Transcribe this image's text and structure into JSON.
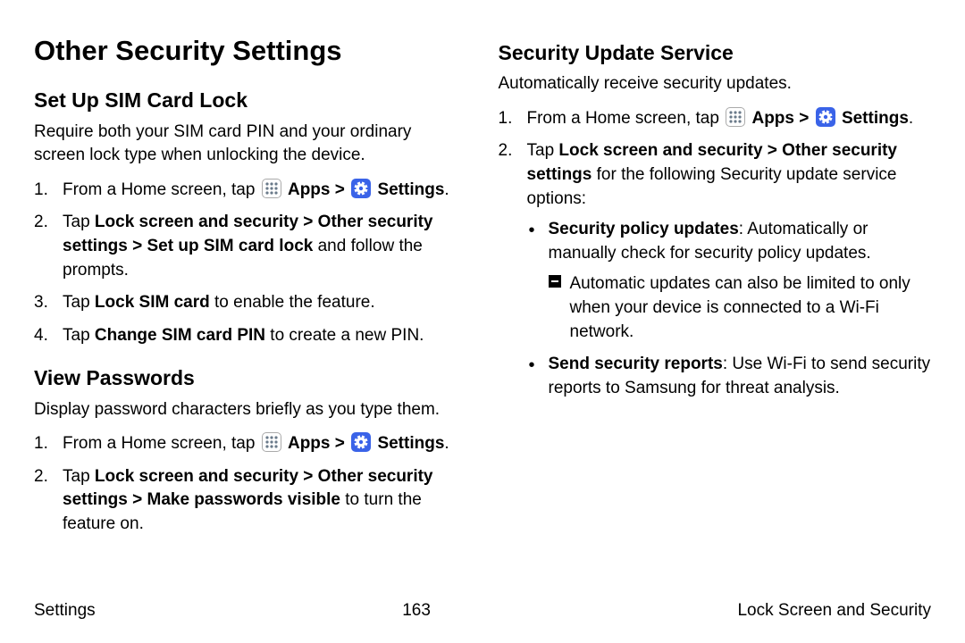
{
  "page": {
    "title": "Other Security Settings"
  },
  "labels": {
    "apps": "Apps",
    "settings": "Settings",
    "chevron": ">"
  },
  "sim": {
    "heading": "Set Up SIM Card Lock",
    "lead": "Require both your SIM card PIN and your ordinary screen lock type when unlocking the device.",
    "step1_a": "From a Home screen, tap ",
    "step2_a": "Tap ",
    "step2_b": "Lock screen and security > Other security settings > Set up SIM card lock",
    "step2_c": " and follow the prompts.",
    "step3_a": "Tap ",
    "step3_b": "Lock SIM card",
    "step3_c": " to enable the feature.",
    "step4_a": "Tap ",
    "step4_b": "Change SIM card PIN",
    "step4_c": " to create a new PIN."
  },
  "pwd": {
    "heading": "View Passwords",
    "lead": "Display password characters briefly as you type them.",
    "step1_a": "From a Home screen, tap ",
    "step2_a": "Tap ",
    "step2_b": "Lock screen and security > Other security settings > Make passwords visible",
    "step2_c": " to turn the feature on."
  },
  "sus": {
    "heading": "Security Update Service",
    "lead": "Automatically receive security updates.",
    "step1_a": "From a Home screen, tap ",
    "step2_a": "Tap ",
    "step2_b": "Lock screen and security > Other security settings",
    "step2_c": " for the following Security update service options:",
    "bullet1_a": "Security policy updates",
    "bullet1_b": ": Automatically or manually check for security policy updates.",
    "bullet1_sub": "Automatic updates can also be limited to only when your device is connected to a Wi-Fi network.",
    "bullet2_a": "Send security reports",
    "bullet2_b": ": Use Wi-Fi to send security reports to Samsung for threat analysis."
  },
  "footer": {
    "left": "Settings",
    "center": "163",
    "right": "Lock Screen and Security"
  }
}
